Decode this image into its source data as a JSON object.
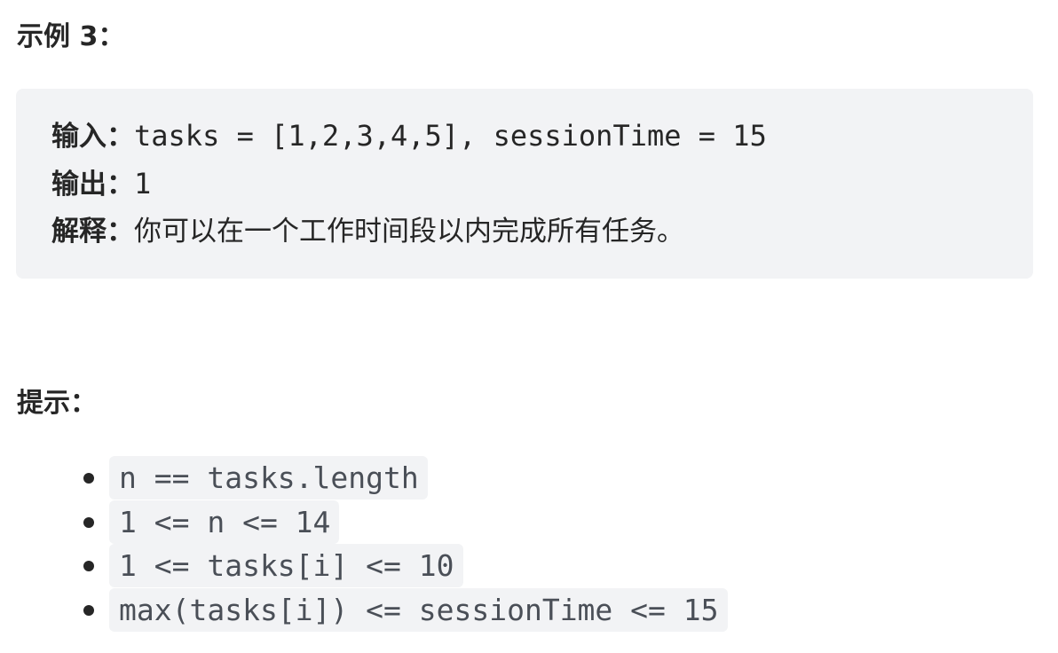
{
  "example": {
    "heading": "示例 3：",
    "input_label": "输入：",
    "input_value": "tasks = [1,2,3,4,5], sessionTime = 15",
    "output_label": "输出：",
    "output_value": "1",
    "explanation_label": "解释：",
    "explanation_value": "你可以在一个工作时间段以内完成所有任务。"
  },
  "hints": {
    "heading": "提示：",
    "items": [
      "n == tasks.length",
      "1 <= n <= 14",
      "1 <= tasks[i] <= 10",
      "max(tasks[i]) <= sessionTime <= 15"
    ]
  },
  "colors": {
    "text": "#262626",
    "code_background": "#f2f3f5",
    "code_text": "#4a4f57"
  }
}
